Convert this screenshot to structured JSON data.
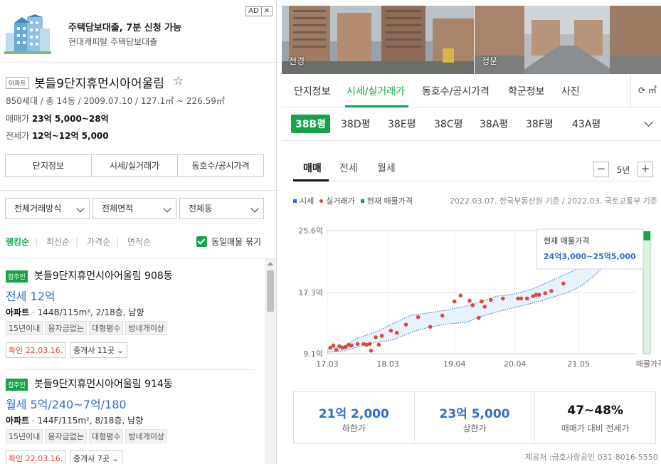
{
  "ad": {
    "title": "주택담보대출, 7분 신청 가능",
    "subtitle": "현대캐피탈 주택담보대출",
    "ad_label": "AD",
    "close_label": "✕"
  },
  "complex": {
    "type_tag": "아파트",
    "name": "봇들9단지휴먼시아어울림",
    "star": "☆",
    "meta": "850세대 / 총 14동 / 2009.07.10 / 127.1㎡ ~ 226.59㎡",
    "sale_label": "매매가",
    "sale_value": "23억 5,000~28억",
    "jeonse_label": "전세가",
    "jeonse_value": "12억~12억 5,000"
  },
  "left_tabs": [
    "단지정보",
    "시세/실거래가",
    "동호수/공시가격"
  ],
  "filters": [
    "전체거래방식",
    "전체면적",
    "전체동"
  ],
  "sort": {
    "options": [
      "랭킹순",
      "최신순",
      "가격순",
      "면적순"
    ],
    "group_label": "동일매물 묶기"
  },
  "listings": [
    {
      "owner_tag": "집주인",
      "name": "봇들9단지휴먼시아어울림 908동",
      "price": "전세 12억",
      "type": "아파트",
      "spec": "· 144B/115m², 2/18층, 남향",
      "tags": [
        "15년이내",
        "융자금없는",
        "대형평수",
        "방네개이상"
      ],
      "confirm": "확인 22.03.16.",
      "agents": "중개사 11곳 ⌄"
    },
    {
      "owner_tag": "집주인",
      "name": "봇들9단지휴먼시아어울림 914동",
      "price": "월세 5억/240~7억/180",
      "type": "아파트",
      "spec": "· 144F/115m², 8/18층, 남향",
      "tags": [
        "15년이내",
        "융자금없는",
        "대형평수",
        "방네개이상"
      ],
      "confirm": "확인 22.03.16.",
      "agents": "중개사 7곳 ⌄"
    }
  ],
  "photos": [
    {
      "caption": "전경"
    },
    {
      "caption": "정문"
    }
  ],
  "right_tabs": [
    "단지정보",
    "시세/실거래가",
    "동호수/공시가격",
    "학군정보",
    "사진"
  ],
  "share_label": "⟳ ㎡",
  "pyeong_types": [
    "38B평",
    "38D평",
    "38E평",
    "38C평",
    "38A평",
    "38F평",
    "43A평"
  ],
  "trade_tabs": [
    "매매",
    "전세",
    "월세"
  ],
  "period": {
    "minus": "−",
    "value": "5년",
    "plus": "+"
  },
  "legend": {
    "market": "시세",
    "actual": "실거래가",
    "current": "현재 매물가격",
    "source_note": "2022.03.07. 한국부동산원 기준 / 2022.03. 국토교통부 기준"
  },
  "colors": {
    "accent": "#16a34a",
    "market_line": "#2f6fcd",
    "actual_dot": "#e0463f",
    "band_fill": "#e7f3fc"
  },
  "chart_data": {
    "type": "line",
    "x_tick_labels": [
      "17.03",
      "18.03",
      "19.04",
      "20.04",
      "21.05",
      "매물가격"
    ],
    "y_tick_labels": [
      "9.1억",
      "17.3억",
      "25.6억"
    ],
    "ylim": [
      9.1,
      25.6
    ],
    "tooltip": {
      "title": "현재 매물가격",
      "value": "24억3,000~25억5,000"
    },
    "current_listing_range": [
      24.3,
      25.5
    ],
    "series": [
      {
        "name": "시세",
        "x": [
          2017.2,
          2017.5,
          2017.7,
          2018.0,
          2018.3,
          2018.6,
          2018.9,
          2019.2,
          2019.5,
          2019.7,
          2020.0,
          2020.3,
          2020.6,
          2020.9,
          2021.2,
          2021.4,
          2021.6,
          2021.85
        ],
        "upper": [
          9.7,
          10.2,
          11.2,
          12.0,
          13.2,
          14.3,
          14.6,
          15.0,
          15.5,
          16.0,
          16.8,
          17.1,
          17.8,
          18.9,
          20.0,
          20.7,
          21.7,
          23.5
        ],
        "lower": [
          9.3,
          9.5,
          10.0,
          10.6,
          11.0,
          12.0,
          12.7,
          13.1,
          13.3,
          14.0,
          14.7,
          15.3,
          15.9,
          16.6,
          17.4,
          18.2,
          19.5,
          21.5
        ]
      },
      {
        "name": "실거래가",
        "x": [
          2017.25,
          2017.3,
          2017.35,
          2017.4,
          2017.45,
          2017.5,
          2017.55,
          2017.6,
          2017.7,
          2017.8,
          2017.85,
          2017.9,
          2017.92,
          2018.0,
          2018.05,
          2018.1,
          2018.25,
          2018.35,
          2018.5,
          2018.7,
          2018.9,
          2019.1,
          2019.3,
          2019.4,
          2019.55,
          2019.6,
          2019.7,
          2019.75,
          2019.8,
          2019.9,
          2020.1,
          2020.35,
          2020.4,
          2020.5,
          2020.6,
          2020.65,
          2020.7,
          2020.8,
          2020.9,
          2021.1
        ],
        "y": [
          9.9,
          10.2,
          9.6,
          10.1,
          9.9,
          10.0,
          10.3,
          10.2,
          10.4,
          10.4,
          10.3,
          10.4,
          9.5,
          11.3,
          10.3,
          11.5,
          12.2,
          11.9,
          13.0,
          14.0,
          12.7,
          14.2,
          16.1,
          16.9,
          16.2,
          15.6,
          13.9,
          16.1,
          15.4,
          16.3,
          16.5,
          16.5,
          16.5,
          16.5,
          16.8,
          17.0,
          17.0,
          17.2,
          17.5,
          18.5
        ]
      }
    ]
  },
  "stats": [
    {
      "value": "21억 2,000",
      "label": "하한가"
    },
    {
      "value": "23억 5,000",
      "label": "상한가"
    },
    {
      "value": "47~48%",
      "label": "매매가 대비 전세가"
    }
  ],
  "provider": "제공처 :금호사랑공인 031-8016-5550"
}
